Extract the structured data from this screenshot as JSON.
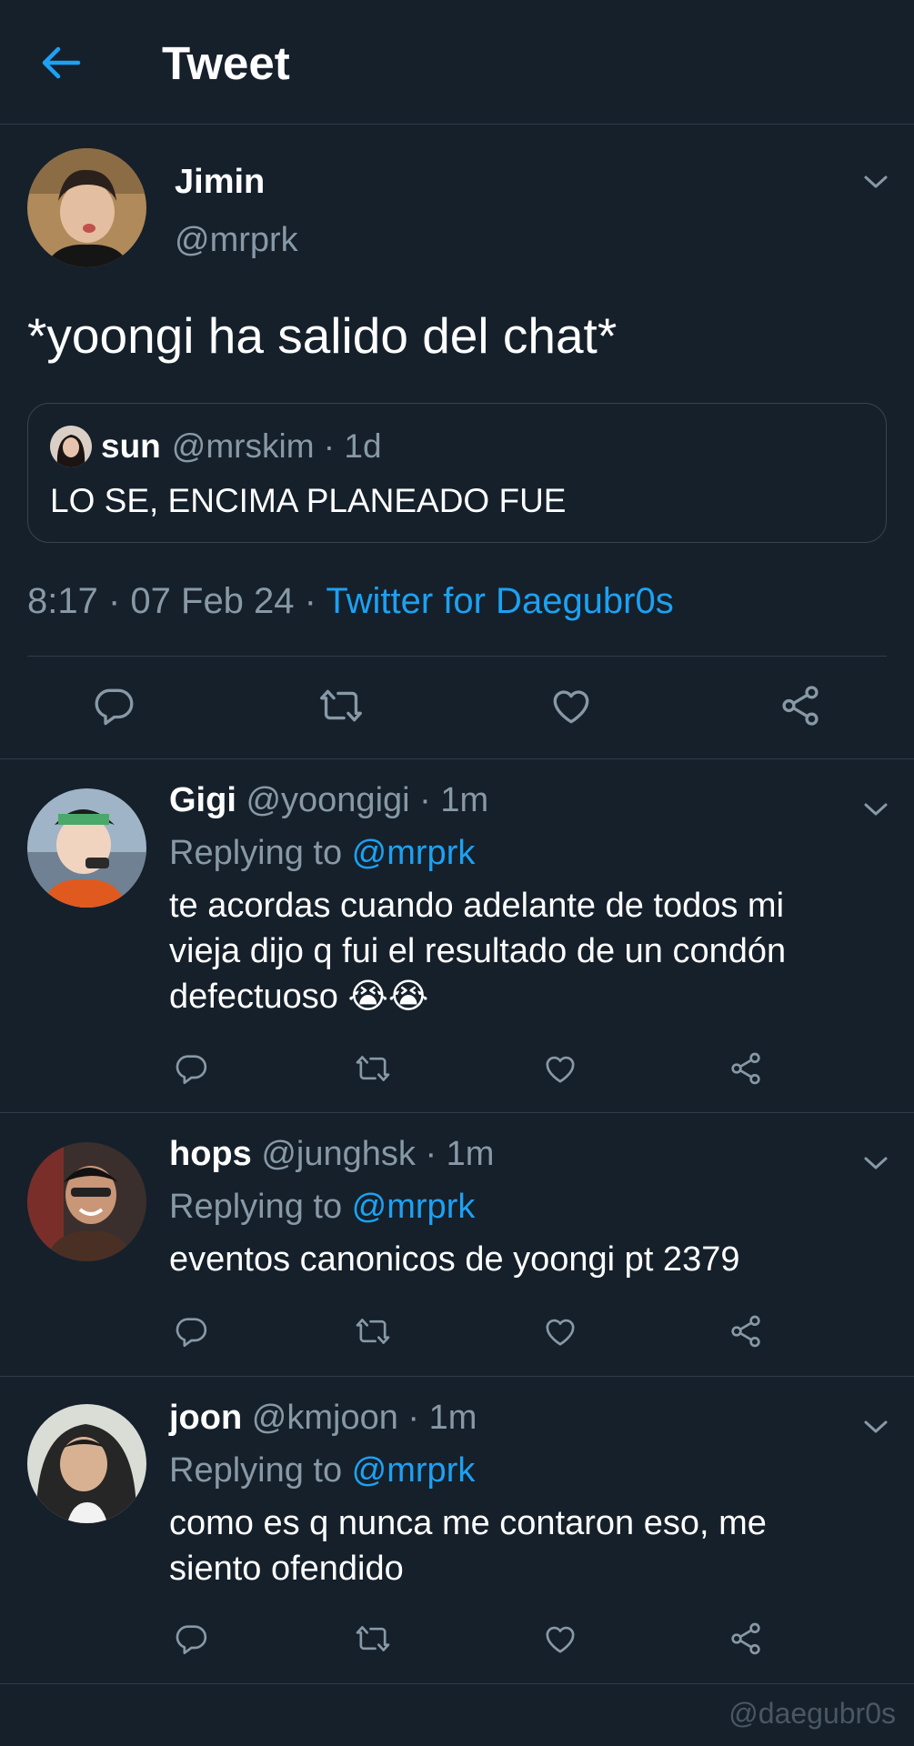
{
  "header": {
    "title": "Tweet",
    "back_icon": "arrow-left-icon"
  },
  "main_tweet": {
    "name": "Jimin",
    "handle": "@mrprk",
    "text": "*yoongi ha salido del chat*",
    "quoted": {
      "name": "sun",
      "meta": "@mrskim · 1d",
      "text": "LO SE, ENCIMA PLANEADO FUE"
    },
    "timestamp": "8:17 · 07 Feb 24 · ",
    "source": "Twitter for Daegubr0s"
  },
  "replies": [
    {
      "name": "Gigi",
      "meta": "@yoongigi · 1m",
      "replying_prefix": "Replying to ",
      "replying_to": "@mrprk",
      "text": "te acordas cuando adelante de todos mi vieja dijo q fui el resultado de un condón defectuoso 😭😭"
    },
    {
      "name": "hops",
      "meta": "@junghsk · 1m",
      "replying_prefix": "Replying to ",
      "replying_to": "@mrprk",
      "text": "eventos canonicos de yoongi pt 2379"
    },
    {
      "name": "joon",
      "meta": "@kmjoon · 1m",
      "replying_prefix": "Replying to ",
      "replying_to": "@mrprk",
      "text": "como es q nunca me contaron eso, me siento ofendido"
    }
  ],
  "watermark": "@daegubr0s",
  "colors": {
    "background": "#15202b",
    "accent": "#1da1f2",
    "secondary_text": "#8899a6",
    "divider": "#2f3b47"
  },
  "icons": [
    "reply-icon",
    "retweet-icon",
    "like-icon",
    "share-icon",
    "chevron-down-icon"
  ]
}
